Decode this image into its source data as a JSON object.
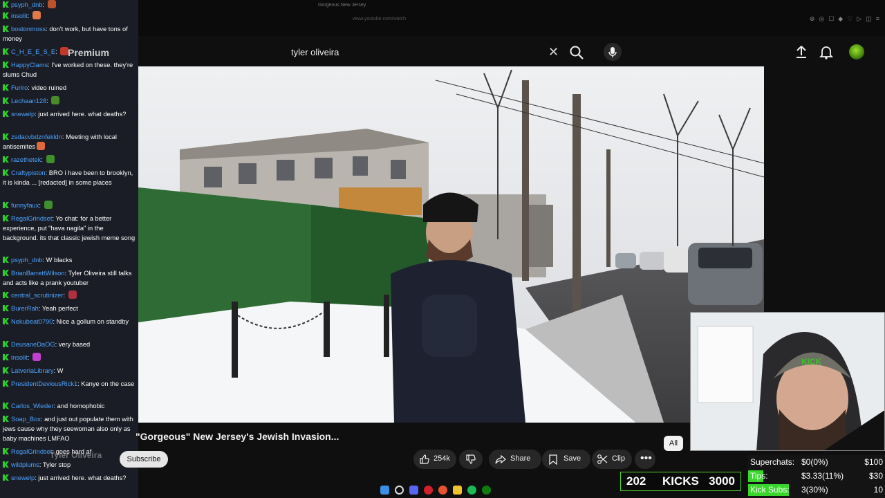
{
  "browser": {
    "tab_title": "Gorgeous New Jersey",
    "url": "www.youtube.com/watch",
    "premium_label": "Premium"
  },
  "youtube": {
    "search_value": "tyler oliveira",
    "video_title": "\"Gorgeous\" New Jersey's Jewish Invasion...",
    "channel_name": "Tyler Oliveira",
    "subscribe_label": "Subscribe",
    "filter_chip": "All",
    "likes": "254k",
    "share_label": "Share",
    "save_label": "Save",
    "clip_label": "Clip"
  },
  "chat": [
    {
      "user": "psyph_dnb",
      "text": "",
      "emote": "#b9532e"
    },
    {
      "user": "insolit",
      "text": "",
      "emote": "#e07a4a"
    },
    {
      "user": "bostonmoss",
      "text": "don't work, but have tons of money"
    },
    {
      "user": "C_H_E_E_S_E",
      "text": "",
      "emote": "#c0392b"
    },
    {
      "user": "HappyClams",
      "text": "I've worked on these. they're slums Chud"
    },
    {
      "user": "Furiro",
      "text": "video ruined"
    },
    {
      "user": "Lechaan128",
      "text": "",
      "emote": "#4a8a2a"
    },
    {
      "user": "snewelp",
      "text": "just arrived here. what deaths?"
    },
    {
      "user": "zsdacvbdznfekldn",
      "text": "Meeting with local antisemites",
      "emote": "#e06a3a"
    },
    {
      "user": "razethetek",
      "text": "",
      "emote": "#3f8f2f"
    },
    {
      "user": "Craftypiston",
      "text": "BRO i have been to brooklyn, it is kinda ... [redacted] in some places"
    },
    {
      "user": "funnyfaux",
      "text": "",
      "emote": "#3f8f2f"
    },
    {
      "user": "RegalGrindset",
      "text": "Yo chat: for a better experience, put \"hava nagila\" in the background. its that classic jewish meme song"
    },
    {
      "user": "psyph_dnb",
      "text": "W blacks"
    },
    {
      "user": "BrianBarrettWilson",
      "text": "Tyler Oliveira still talks and acts like a prank youtuber"
    },
    {
      "user": "central_scrutinizer",
      "text": "",
      "emote": "#b03040"
    },
    {
      "user": "BurerRah",
      "text": "Yeah perfect"
    },
    {
      "user": "Nekubeat0790",
      "text": "Nice a gollum on standby"
    },
    {
      "user": "DeusaneDaOG",
      "text": "very based"
    },
    {
      "user": "insolit",
      "text": "",
      "emote": "#c040d0"
    },
    {
      "user": "LatveriaLibrary",
      "text": "W"
    },
    {
      "user": "PresidentDeviousRick1",
      "text": "Kanye on the case"
    },
    {
      "user": "Carlos_Wieder",
      "text": "and homophobic"
    },
    {
      "user": "Soap_Box",
      "text": "and just out populate them with jews cause why they seewoman also only as baby machines LMFAO"
    },
    {
      "user": "RegalGrindset",
      "text": "goes hard af"
    },
    {
      "user": "wildplums",
      "text": "Tyler stop"
    },
    {
      "user": "snewelp",
      "text": "just arrived here. what deaths?"
    }
  ],
  "kicks": {
    "count": "202",
    "label": "KICKS",
    "goal": "3000",
    "progress": 0.067
  },
  "stats": [
    {
      "label": "Superchats:",
      "value": "$0(0%)",
      "goal": "$100",
      "progress": 0.0
    },
    {
      "label": "Tips:",
      "value": "$3.33(11%)",
      "goal": "$30",
      "progress": 0.11
    },
    {
      "label": "Kick Subs:",
      "value": "3(30%)",
      "goal": "10",
      "progress": 0.3
    }
  ],
  "colors": {
    "accent_green": "#39d62c",
    "chat_username": "#4aa3ff",
    "background": "#0f0f0f"
  }
}
